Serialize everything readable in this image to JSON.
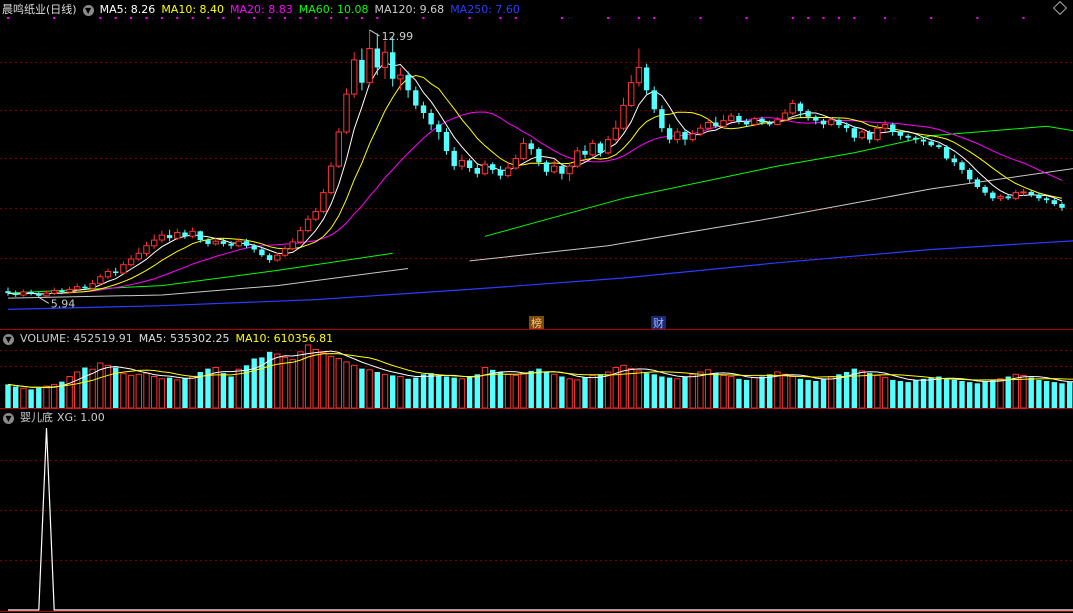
{
  "header": {
    "stock_name": "晨鸣纸业(日线)",
    "ma5": "MA5: 8.26",
    "ma10": "MA10: 8.40",
    "ma20": "MA20: 8.83",
    "ma60": "MA60: 10.08",
    "ma120": "MA120: 9.68",
    "ma250": "MA250: 7.60"
  },
  "volume_header": {
    "volume": "VOLUME: 452519.91",
    "ma5": "MA5: 535302.25",
    "ma10": "MA10: 610356.81"
  },
  "indicator_header": {
    "name": "婴儿底",
    "xg": "XG: 1.00"
  },
  "annotations": {
    "high_label": "12.99",
    "low_label": "5.94",
    "marker1": "榜",
    "marker2": "财"
  },
  "colors": {
    "up": "#ff3232",
    "down": "#54ffff",
    "ma5": "#ffffff",
    "ma10": "#ffff00",
    "ma20": "#ff00ff",
    "ma60": "#00ff00",
    "ma120": "#c8c8c8",
    "ma250": "#2a3cff",
    "grid": "#7a0000"
  },
  "chart_data": [
    {
      "type": "candlestick",
      "title": "晨鸣纸业(日线)",
      "ylim": [
        5.5,
        13.2
      ],
      "candles": [
        [
          6.1,
          6.05,
          6.2,
          5.98
        ],
        [
          6.05,
          6.0,
          6.12,
          5.95
        ],
        [
          6.0,
          6.08,
          6.15,
          5.96
        ],
        [
          6.08,
          6.04,
          6.14,
          5.99
        ],
        [
          6.04,
          5.98,
          6.08,
          5.94
        ],
        [
          5.98,
          6.05,
          6.12,
          5.95
        ],
        [
          6.05,
          6.12,
          6.2,
          6.0
        ],
        [
          6.12,
          6.08,
          6.18,
          6.02
        ],
        [
          6.08,
          6.15,
          6.22,
          6.04
        ],
        [
          6.15,
          6.22,
          6.3,
          6.1
        ],
        [
          6.22,
          6.18,
          6.28,
          6.12
        ],
        [
          6.18,
          6.3,
          6.4,
          6.15
        ],
        [
          6.3,
          6.48,
          6.55,
          6.25
        ],
        [
          6.48,
          6.62,
          6.7,
          6.42
        ],
        [
          6.62,
          6.58,
          6.72,
          6.5
        ],
        [
          6.58,
          6.8,
          6.88,
          6.55
        ],
        [
          6.8,
          6.95,
          7.05,
          6.75
        ],
        [
          6.95,
          7.1,
          7.25,
          6.9
        ],
        [
          7.1,
          7.3,
          7.4,
          7.02
        ],
        [
          7.3,
          7.45,
          7.6,
          7.22
        ],
        [
          7.45,
          7.58,
          7.7,
          7.38
        ],
        [
          7.58,
          7.5,
          7.72,
          7.42
        ],
        [
          7.5,
          7.65,
          7.75,
          7.45
        ],
        [
          7.65,
          7.55,
          7.72,
          7.48
        ],
        [
          7.55,
          7.68,
          7.78,
          7.5
        ],
        [
          7.68,
          7.45,
          7.7,
          7.38
        ],
        [
          7.45,
          7.35,
          7.5,
          7.28
        ],
        [
          7.35,
          7.42,
          7.52,
          7.3
        ],
        [
          7.42,
          7.35,
          7.48,
          7.28
        ],
        [
          7.35,
          7.3,
          7.42,
          7.22
        ],
        [
          7.3,
          7.42,
          7.5,
          7.26
        ],
        [
          7.42,
          7.3,
          7.48,
          7.24
        ],
        [
          7.3,
          7.2,
          7.35,
          7.12
        ],
        [
          7.2,
          7.05,
          7.25,
          7.0
        ],
        [
          7.05,
          6.92,
          7.1,
          6.85
        ],
        [
          6.92,
          7.05,
          7.12,
          6.88
        ],
        [
          7.05,
          7.22,
          7.3,
          7.0
        ],
        [
          7.22,
          7.4,
          7.5,
          7.18
        ],
        [
          7.4,
          7.7,
          7.8,
          7.35
        ],
        [
          7.7,
          8.0,
          8.1,
          7.65
        ],
        [
          8.0,
          8.2,
          8.3,
          7.95
        ],
        [
          8.2,
          8.7,
          8.8,
          8.15
        ],
        [
          8.7,
          9.4,
          9.5,
          8.65
        ],
        [
          9.4,
          10.3,
          10.4,
          9.35
        ],
        [
          10.3,
          11.3,
          11.45,
          10.25
        ],
        [
          11.3,
          12.2,
          12.4,
          11.2
        ],
        [
          12.2,
          11.6,
          12.5,
          11.4
        ],
        [
          11.6,
          12.5,
          12.99,
          11.5
        ],
        [
          12.5,
          12.0,
          12.9,
          11.8
        ],
        [
          12.0,
          12.4,
          12.7,
          11.7
        ],
        [
          12.4,
          11.7,
          12.8,
          11.5
        ],
        [
          11.7,
          11.8,
          12.0,
          11.4
        ],
        [
          11.8,
          11.4,
          11.9,
          11.2
        ],
        [
          11.4,
          11.0,
          11.5,
          10.9
        ],
        [
          11.0,
          10.8,
          11.1,
          10.65
        ],
        [
          10.8,
          10.5,
          10.9,
          10.35
        ],
        [
          10.5,
          10.3,
          10.6,
          10.1
        ],
        [
          10.3,
          9.8,
          10.4,
          9.7
        ],
        [
          9.8,
          9.4,
          9.9,
          9.3
        ],
        [
          9.4,
          9.55,
          9.7,
          9.3
        ],
        [
          9.55,
          9.35,
          9.6,
          9.25
        ],
        [
          9.35,
          9.2,
          9.45,
          9.1
        ],
        [
          9.2,
          9.45,
          9.55,
          9.15
        ],
        [
          9.45,
          9.3,
          9.5,
          9.2
        ],
        [
          9.3,
          9.15,
          9.4,
          9.05
        ],
        [
          9.15,
          9.35,
          9.5,
          9.1
        ],
        [
          9.35,
          9.6,
          9.7,
          9.3
        ],
        [
          9.6,
          10.0,
          10.15,
          9.55
        ],
        [
          10.0,
          9.85,
          10.1,
          9.7
        ],
        [
          9.85,
          9.5,
          9.9,
          9.4
        ],
        [
          9.5,
          9.25,
          9.55,
          9.15
        ],
        [
          9.25,
          9.4,
          9.55,
          9.2
        ],
        [
          9.4,
          9.2,
          9.45,
          9.05
        ],
        [
          9.2,
          9.4,
          9.5,
          9.0
        ],
        [
          9.4,
          9.8,
          9.9,
          9.35
        ],
        [
          9.8,
          9.7,
          9.95,
          9.6
        ],
        [
          9.7,
          10.0,
          10.1,
          9.65
        ],
        [
          10.0,
          9.75,
          10.05,
          9.65
        ],
        [
          9.75,
          10.1,
          10.2,
          9.7
        ],
        [
          10.1,
          10.4,
          10.6,
          10.05
        ],
        [
          10.4,
          11.0,
          11.2,
          10.35
        ],
        [
          11.0,
          11.6,
          11.8,
          10.95
        ],
        [
          11.6,
          12.0,
          12.5,
          11.5
        ],
        [
          12.0,
          11.4,
          12.1,
          11.3
        ],
        [
          11.4,
          10.9,
          11.5,
          10.8
        ],
        [
          10.9,
          10.4,
          11.0,
          10.3
        ],
        [
          10.4,
          10.1,
          10.5,
          10.0
        ],
        [
          10.1,
          10.3,
          10.4,
          10.0
        ],
        [
          10.3,
          10.1,
          10.35,
          9.95
        ],
        [
          10.1,
          10.25,
          10.35,
          10.05
        ],
        [
          10.25,
          10.4,
          10.5,
          10.2
        ],
        [
          10.4,
          10.55,
          10.65,
          10.35
        ],
        [
          10.55,
          10.45,
          10.7,
          10.4
        ],
        [
          10.45,
          10.6,
          10.75,
          10.4
        ],
        [
          10.6,
          10.72,
          10.8,
          10.55
        ],
        [
          10.72,
          10.58,
          10.8,
          10.5
        ],
        [
          10.58,
          10.5,
          10.65,
          10.45
        ],
        [
          10.5,
          10.65,
          10.7,
          10.45
        ],
        [
          10.65,
          10.55,
          10.7,
          10.48
        ],
        [
          10.55,
          10.5,
          10.6,
          10.45
        ],
        [
          10.5,
          10.62,
          10.7,
          10.48
        ],
        [
          10.62,
          10.8,
          10.9,
          10.58
        ],
        [
          10.8,
          11.05,
          11.15,
          10.75
        ],
        [
          11.05,
          10.85,
          11.1,
          10.7
        ],
        [
          10.85,
          10.7,
          10.9,
          10.6
        ],
        [
          10.7,
          10.6,
          10.75,
          10.5
        ],
        [
          10.6,
          10.5,
          10.65,
          10.4
        ],
        [
          10.5,
          10.62,
          10.7,
          10.45
        ],
        [
          10.62,
          10.48,
          10.65,
          10.4
        ],
        [
          10.48,
          10.4,
          10.55,
          10.3
        ],
        [
          10.4,
          10.15,
          10.45,
          10.05
        ],
        [
          10.15,
          10.3,
          10.4,
          10.1
        ],
        [
          10.3,
          10.1,
          10.35,
          10.0
        ],
        [
          10.1,
          10.4,
          10.5,
          10.05
        ],
        [
          10.4,
          10.5,
          10.6,
          10.3
        ],
        [
          10.5,
          10.3,
          10.55,
          10.2
        ],
        [
          10.3,
          10.2,
          10.35,
          10.1
        ],
        [
          10.2,
          10.15,
          10.25,
          10.05
        ],
        [
          10.15,
          10.1,
          10.2,
          10.0
        ],
        [
          10.1,
          10.05,
          10.15,
          9.95
        ],
        [
          10.05,
          9.95,
          10.1,
          9.9
        ],
        [
          9.95,
          9.9,
          10.0,
          9.85
        ],
        [
          9.9,
          9.6,
          9.95,
          9.55
        ],
        [
          9.6,
          9.5,
          9.7,
          9.4
        ],
        [
          9.5,
          9.3,
          9.55,
          9.2
        ],
        [
          9.3,
          9.05,
          9.35,
          8.95
        ],
        [
          9.05,
          8.85,
          9.1,
          8.8
        ],
        [
          8.85,
          8.7,
          8.9,
          8.62
        ],
        [
          8.7,
          8.55,
          8.75,
          8.48
        ],
        [
          8.55,
          8.6,
          8.65,
          8.48
        ],
        [
          8.6,
          8.55,
          8.65,
          8.5
        ],
        [
          8.55,
          8.7,
          8.78,
          8.5
        ],
        [
          8.7,
          8.72,
          8.8,
          8.62
        ],
        [
          8.72,
          8.65,
          8.78,
          8.58
        ],
        [
          8.65,
          8.55,
          8.7,
          8.48
        ],
        [
          8.55,
          8.5,
          8.6,
          8.42
        ],
        [
          8.5,
          8.4,
          8.55,
          8.35
        ],
        [
          8.4,
          8.3,
          8.45,
          8.22
        ]
      ],
      "annotations": [
        "12.99",
        "5.94"
      ],
      "ma_lines": {
        "MA250": [
          [
            0,
            5.62
          ],
          [
            20,
            5.72
          ],
          [
            40,
            5.88
          ],
          [
            60,
            6.15
          ],
          [
            80,
            6.45
          ],
          [
            100,
            6.85
          ],
          [
            120,
            7.2
          ],
          [
            140,
            7.45
          ],
          [
            146,
            7.6
          ]
        ],
        "MA120": [
          [
            0,
            5.92
          ],
          [
            20,
            6.0
          ],
          [
            35,
            6.25
          ],
          [
            52,
            6.7
          ],
          [
            60,
            6.9
          ],
          [
            78,
            7.3
          ],
          [
            100,
            8.05
          ],
          [
            120,
            8.8
          ],
          [
            140,
            9.38
          ],
          [
            146,
            9.68
          ]
        ],
        "MA60": [
          [
            0,
            6.05
          ],
          [
            20,
            6.25
          ],
          [
            35,
            6.65
          ],
          [
            50,
            7.1
          ],
          [
            62,
            7.55
          ],
          [
            80,
            8.55
          ],
          [
            100,
            9.4
          ],
          [
            110,
            9.75
          ],
          [
            120,
            10.2
          ],
          [
            135,
            10.45
          ],
          [
            146,
            10.08
          ]
        ]
      }
    },
    {
      "type": "bar",
      "title": "VOLUME",
      "series": [
        {
          "name": "VOLUME",
          "values": [
            420,
            380,
            350,
            330,
            360,
            390,
            420,
            470,
            560,
            640,
            720,
            690,
            800,
            760,
            720,
            610,
            580,
            600,
            620,
            560,
            520,
            540,
            500,
            530,
            560,
            640,
            700,
            720,
            620,
            560,
            690,
            760,
            880,
            900,
            1000,
            960,
            900,
            860,
            1000,
            1120,
            1040,
            980,
            920,
            880,
            820,
            760,
            700,
            680,
            640,
            600,
            580,
            560,
            520,
            540,
            600,
            620,
            580,
            560,
            540,
            520,
            560,
            600,
            720,
            680,
            640,
            600,
            580,
            620,
            660,
            700,
            640,
            600,
            560,
            520,
            500,
            540,
            580,
            600,
            640,
            720,
            760,
            700,
            660,
            620,
            600,
            560,
            540,
            520,
            560,
            600,
            640,
            680,
            620,
            580,
            560,
            520,
            500,
            540,
            560,
            600,
            640,
            600,
            560,
            520,
            500,
            480,
            520,
            560,
            600,
            640,
            700,
            660,
            620,
            580,
            540,
            500,
            480,
            460,
            500,
            520,
            540,
            560,
            520,
            500,
            480,
            460,
            440,
            480,
            500,
            520,
            560,
            600,
            580,
            540,
            500,
            480,
            460,
            440,
            460,
            480,
            500,
            460,
            440,
            420,
            400,
            450
          ]
        }
      ]
    },
    {
      "type": "line",
      "title": "婴儿底",
      "series": [
        {
          "name": "XG",
          "values": [
            [
              0,
              0
            ],
            [
              4,
              0
            ],
            [
              5,
              1
            ],
            [
              6,
              0
            ],
            [
              144,
              0
            ],
            [
              145,
              1
            ]
          ]
        }
      ]
    }
  ]
}
